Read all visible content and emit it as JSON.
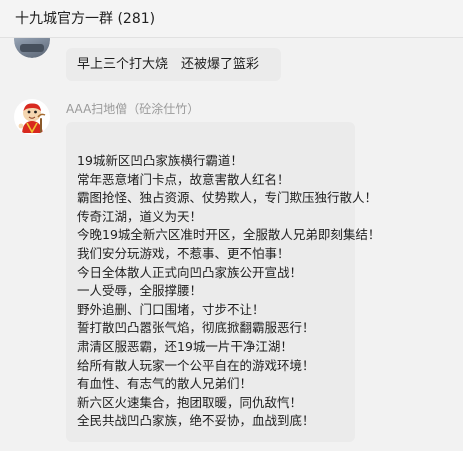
{
  "header": {
    "title": "十九城官方一群 (281)"
  },
  "messages": [
    {
      "text": "早上三个打大烧　还被爆了篮彩"
    },
    {
      "sender": "AAA扫地僧（砼涂仕竹）",
      "lines": [
        "19城新区凹凸家族横行霸道！",
        "常年恶意堵门卡点，故意害散人红名！",
        "霸图抢怪、独占资源、仗势欺人，专门欺压独行散人！",
        "传奇江湖，道义为天！",
        "今晚19城全新六区准时开区，全服散人兄弟即刻集结！",
        "我们安分玩游戏，不惹事、更不怕事！",
        "今日全体散人正式向凹凸家族公开宣战！",
        "一人受辱，全服撑腰！",
        "野外追删、门口围堵，寸步不让！",
        "誓打散凹凸嚣张气焰，彻底掀翻霸服恶行！",
        "肃清区服恶霸，还19城一片干净江湖！",
        "给所有散人玩家一个公平自在的游戏环境！",
        "有血性、有志气的散人兄弟们！",
        "新六区火速集合，抱团取暖，同仇敌忾！",
        "全民共战凹凸家族，绝不妥协，血战到底！"
      ]
    }
  ],
  "icons": {
    "avatar_top": "avatar-icon",
    "avatar_sender": "cartoon-monk-avatar-icon"
  }
}
